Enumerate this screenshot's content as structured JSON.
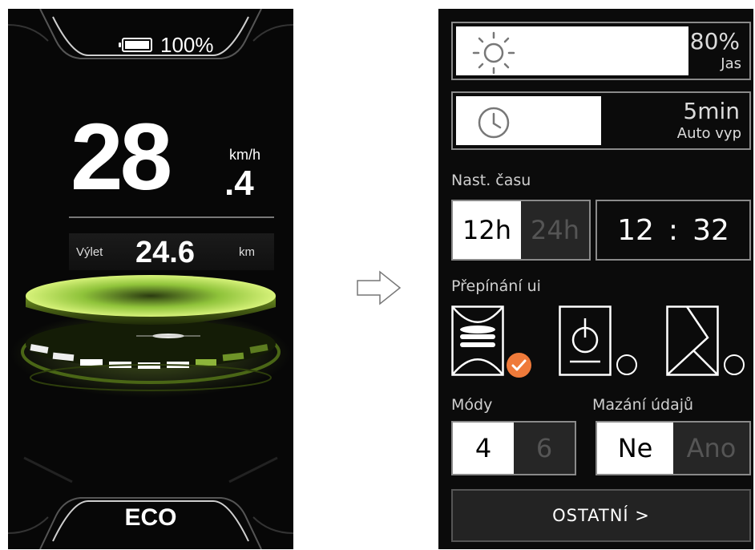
{
  "left_display": {
    "battery_text": "100%",
    "speed_integer": "28",
    "speed_decimal": ".4",
    "speed_unit": "km/h",
    "trip_label": "Výlet",
    "trip_value": "24.6",
    "trip_unit": "km",
    "mode": "ECO",
    "assist_color": "#b6e84a"
  },
  "right_settings": {
    "brightness": {
      "value": "80%",
      "label": "Jas",
      "level": 0.8,
      "icon": "sun-icon"
    },
    "auto_off": {
      "value": "5min",
      "label": "Auto vyp",
      "level": 0.5,
      "icon": "clock-icon"
    },
    "time_setting": {
      "label": "Nast. času",
      "format_options": [
        "12h",
        "24h"
      ],
      "selected_format": "12h",
      "hour": "12",
      "separator": ":",
      "minute": "32"
    },
    "ui_switch": {
      "label": "Přepínání ui",
      "options": [
        {
          "icon": "ui-layout-1-icon",
          "selected": true
        },
        {
          "icon": "ui-layout-2-icon",
          "selected": false
        },
        {
          "icon": "ui-layout-3-icon",
          "selected": false
        }
      ],
      "check_color": "#ef7a3a"
    },
    "modes": {
      "label": "Módy",
      "options": [
        "4",
        "6"
      ],
      "selected": "4"
    },
    "clear_data": {
      "label": "Mazání údajů",
      "options": [
        "Ne",
        "Ano"
      ],
      "selected": "Ne"
    },
    "other_button": "OSTATNÍ >"
  },
  "transition_arrow_icon": "arrow-right-outline-icon"
}
